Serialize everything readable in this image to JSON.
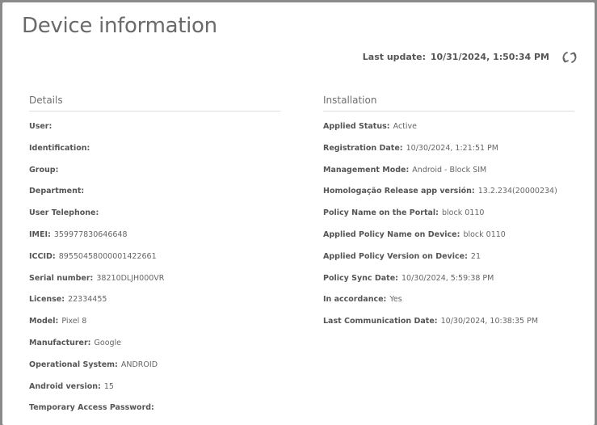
{
  "dialog": {
    "title": "Device information",
    "last_update_label": "Last update:",
    "last_update_value": "10/31/2024, 1:50:34 PM",
    "refresh_icon": "refresh-icon"
  },
  "details": {
    "heading": "Details",
    "rows": [
      {
        "label": "User:",
        "value": ""
      },
      {
        "label": "Identification:",
        "value": ""
      },
      {
        "label": "Group:",
        "value": ""
      },
      {
        "label": "Department:",
        "value": ""
      },
      {
        "label": "User Telephone:",
        "value": ""
      },
      {
        "label": "IMEI:",
        "value": "359977830646648"
      },
      {
        "label": "ICCID:",
        "value": "89550458000001422661"
      },
      {
        "label": "Serial number:",
        "value": "38210DLJH000VR"
      },
      {
        "label": "License:",
        "value": "22334455"
      },
      {
        "label": "Model:",
        "value": "Pixel 8"
      },
      {
        "label": "Manufacturer:",
        "value": "Google"
      },
      {
        "label": "Operational System:",
        "value": "ANDROID"
      },
      {
        "label": "Android version:",
        "value": "15"
      },
      {
        "label": "Temporary Access Password:",
        "value": ""
      }
    ]
  },
  "installation": {
    "heading": "Installation",
    "rows": [
      {
        "label": "Applied Status:",
        "value": "Active"
      },
      {
        "label": "Registration Date:",
        "value": "10/30/2024, 1:21:51 PM"
      },
      {
        "label": "Management Mode:",
        "value": "Android - Block SIM"
      },
      {
        "label": "Homologação Release app versión:",
        "value": "13.2.234(20000234)"
      },
      {
        "label": "Policy Name on the Portal:",
        "value": "block 0110"
      },
      {
        "label": "Applied Policy Name on Device:",
        "value": "block 0110"
      },
      {
        "label": "Applied Policy Version on Device:",
        "value": "21"
      },
      {
        "label": "Policy Sync Date:",
        "value": "10/30/2024, 5:59:38 PM"
      },
      {
        "label": "In accordance:",
        "value": "Yes"
      },
      {
        "label": "Last Communication Date:",
        "value": "10/30/2024, 10:38:35 PM"
      }
    ]
  }
}
